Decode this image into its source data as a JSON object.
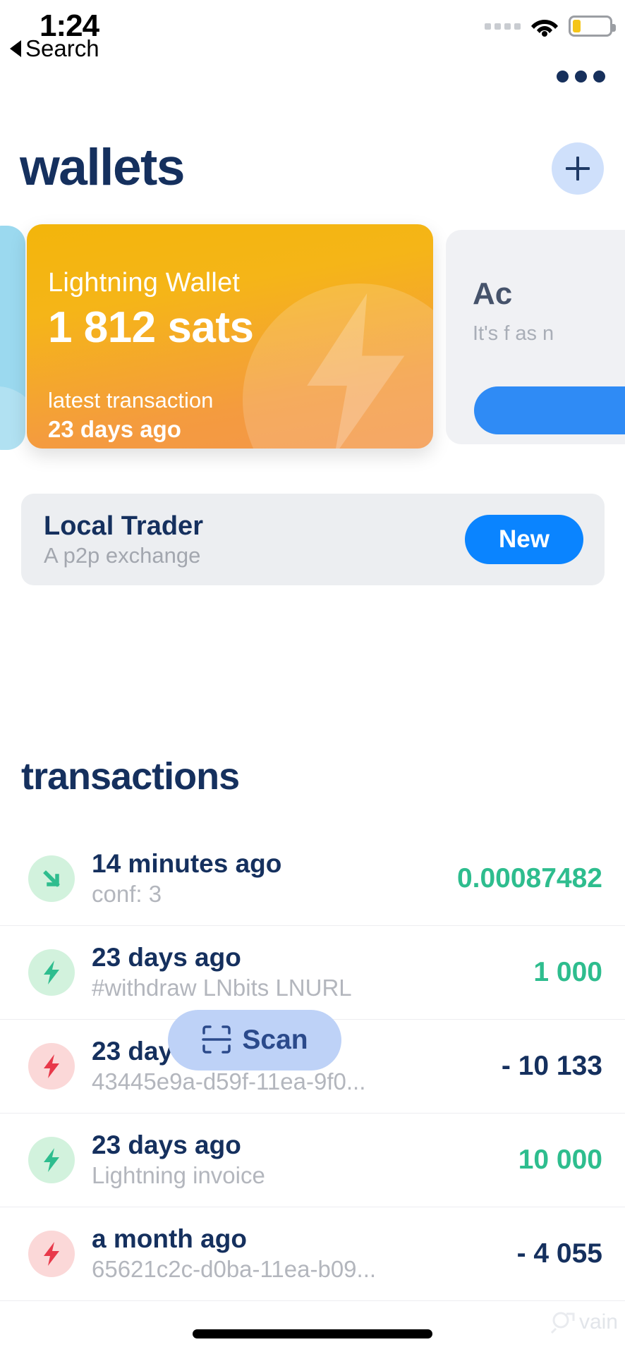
{
  "status_bar": {
    "time": "1:24",
    "back_label": "Search",
    "signal_icon": "signal-dots-icon",
    "wifi_icon": "wifi-icon",
    "battery_icon": "battery-low-icon",
    "battery_level_percent": 22
  },
  "header": {
    "overflow_icon": "overflow-menu-icon",
    "title": "wallets",
    "add_label": "+",
    "add_icon": "plus-icon"
  },
  "carousel": {
    "prev_card": {
      "name": "previous-wallet-card",
      "color": "#9bd9ef"
    },
    "active_card": {
      "name": "Lightning Wallet",
      "balance": "1 812 sats",
      "latest_label": "latest transaction",
      "latest_value": "23 days ago",
      "gradient_from": "#f3b50b",
      "gradient_to": "#f3974a",
      "bolt_icon": "lightning-bolt-icon"
    },
    "next_card": {
      "title": "Ac",
      "subtitle": "It's f\nas n",
      "button_label": "",
      "bg": "#f0f1f4",
      "button_color": "#2f8bf5"
    }
  },
  "local_trader": {
    "title": "Local Trader",
    "subtitle": "A p2p exchange",
    "button_label": "New",
    "button_color": "#0a84ff"
  },
  "transactions": {
    "heading": "transactions",
    "rows": [
      {
        "icon": "arrow-down-right-icon",
        "direction": "incoming-onchain",
        "time": "14 minutes ago",
        "description": "conf: 3",
        "amount": "0.00087482",
        "sign": "positive"
      },
      {
        "icon": "lightning-bolt-icon",
        "direction": "incoming-lightning",
        "time": "23 days ago",
        "description": "#withdraw LNbits LNURL",
        "amount": "1 000",
        "sign": "positive"
      },
      {
        "icon": "lightning-bolt-icon",
        "direction": "outgoing-lightning",
        "time": "23 days ago",
        "description": "43445e9a-d59f-11ea-9f0...",
        "amount": "- 10 133",
        "sign": "negative"
      },
      {
        "icon": "lightning-bolt-icon",
        "direction": "incoming-lightning",
        "time": "23 days ago",
        "description": "Lightning invoice",
        "amount": "10 000",
        "sign": "positive"
      },
      {
        "icon": "lightning-bolt-icon",
        "direction": "outgoing-lightning",
        "time": "a month ago",
        "description": "65621c2c-d0ba-11ea-b09...",
        "amount": "- 4 055",
        "sign": "negative"
      }
    ]
  },
  "scan_button": {
    "label": "Scan",
    "icon": "qr-scan-icon",
    "bg": "#bed2f7",
    "text_color": "#2b4a8b"
  },
  "watermark": {
    "text": "vain"
  },
  "colors": {
    "navy": "#15305e",
    "green": "#2ebd8e",
    "red": "#e8394a",
    "blue": "#0a84ff"
  }
}
